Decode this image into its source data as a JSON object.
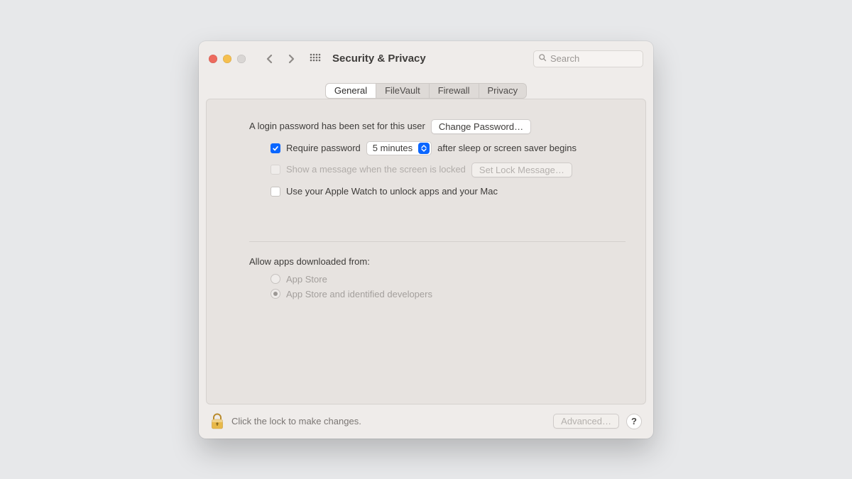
{
  "header": {
    "title": "Security & Privacy",
    "search_placeholder": "Search"
  },
  "tabs": {
    "general": "General",
    "filevault": "FileVault",
    "firewall": "Firewall",
    "privacy": "Privacy"
  },
  "general": {
    "login_pw_set": "A login password has been set for this user",
    "change_password": "Change Password…",
    "require_password_pre": "Require password",
    "require_password_delay": "5 minutes",
    "require_password_post": "after sleep or screen saver begins",
    "show_message": "Show a message when the screen is locked",
    "set_lock_message": "Set Lock Message…",
    "apple_watch": "Use your Apple Watch to unlock apps and your Mac",
    "allow_apps_label": "Allow apps downloaded from:",
    "radio_appstore": "App Store",
    "radio_identified": "App Store and identified developers"
  },
  "footer": {
    "lock_text": "Click the lock to make changes.",
    "advanced": "Advanced…",
    "help": "?"
  }
}
